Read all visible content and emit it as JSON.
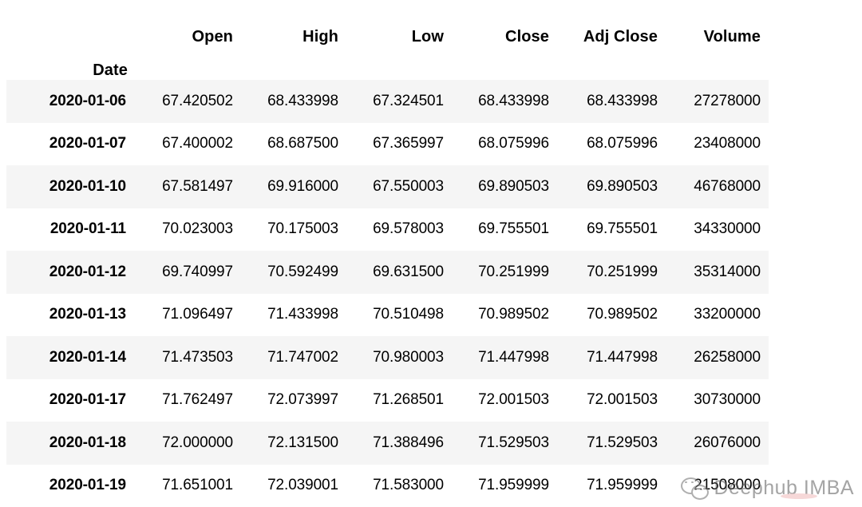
{
  "table": {
    "index_name": "Date",
    "columns": [
      "Open",
      "High",
      "Low",
      "Close",
      "Adj Close",
      "Volume"
    ],
    "rows": [
      {
        "date": "2020-01-06",
        "open": "67.420502",
        "high": "68.433998",
        "low": "67.324501",
        "close": "68.433998",
        "adj_close": "68.433998",
        "volume": "27278000"
      },
      {
        "date": "2020-01-07",
        "open": "67.400002",
        "high": "68.687500",
        "low": "67.365997",
        "close": "68.075996",
        "adj_close": "68.075996",
        "volume": "23408000"
      },
      {
        "date": "2020-01-10",
        "open": "67.581497",
        "high": "69.916000",
        "low": "67.550003",
        "close": "69.890503",
        "adj_close": "69.890503",
        "volume": "46768000"
      },
      {
        "date": "2020-01-11",
        "open": "70.023003",
        "high": "70.175003",
        "low": "69.578003",
        "close": "69.755501",
        "adj_close": "69.755501",
        "volume": "34330000"
      },
      {
        "date": "2020-01-12",
        "open": "69.740997",
        "high": "70.592499",
        "low": "69.631500",
        "close": "70.251999",
        "adj_close": "70.251999",
        "volume": "35314000"
      },
      {
        "date": "2020-01-13",
        "open": "71.096497",
        "high": "71.433998",
        "low": "70.510498",
        "close": "70.989502",
        "adj_close": "70.989502",
        "volume": "33200000"
      },
      {
        "date": "2020-01-14",
        "open": "71.473503",
        "high": "71.747002",
        "low": "70.980003",
        "close": "71.447998",
        "adj_close": "71.447998",
        "volume": "26258000"
      },
      {
        "date": "2020-01-17",
        "open": "71.762497",
        "high": "72.073997",
        "low": "71.268501",
        "close": "72.001503",
        "adj_close": "72.001503",
        "volume": "30730000"
      },
      {
        "date": "2020-01-18",
        "open": "72.000000",
        "high": "72.131500",
        "low": "71.388496",
        "close": "71.529503",
        "adj_close": "71.529503",
        "volume": "26076000"
      },
      {
        "date": "2020-01-19",
        "open": "71.651001",
        "high": "72.039001",
        "low": "71.583000",
        "close": "71.959999",
        "adj_close": "71.959999",
        "volume": "21508000"
      }
    ]
  },
  "watermark": {
    "text": "Deephub IMBA",
    "icon": "wechat-logo-icon"
  },
  "colors": {
    "row_stripe": "#f5f5f5",
    "header_rule": "#111111",
    "text": "#000000",
    "watermark_text": "#5a5a5a"
  }
}
